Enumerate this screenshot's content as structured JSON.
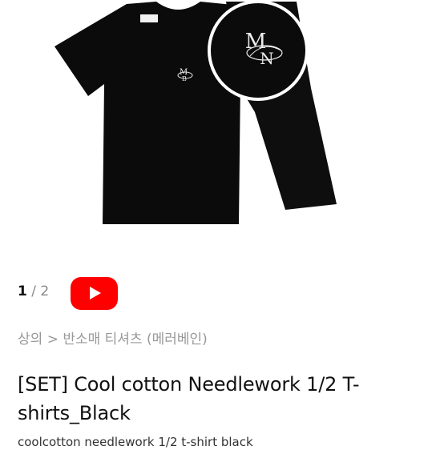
{
  "gallery": {
    "current_index": "1",
    "separator": "/",
    "total_count": "2",
    "logo_text": "MBN"
  },
  "video_button": {
    "icon": "youtube-play-icon",
    "color": "#ff0000"
  },
  "breadcrumb": {
    "category": "상의",
    "separator": ">",
    "subcategory": "반소매 티셔츠 (메러베인)"
  },
  "product": {
    "title": "[SET] Cool cotton Needlework 1/2 T-shirts_Black",
    "subtitle": "coolcotton needlework 1/2 t-shirt black"
  }
}
